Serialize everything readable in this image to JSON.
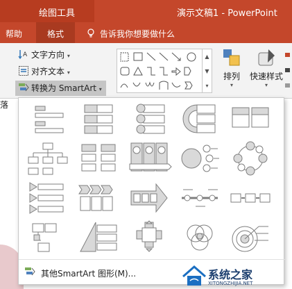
{
  "title_bar": {
    "drawing_tools": "绘图工具",
    "document_title": "演示文稿1  -  PowerPoint"
  },
  "menu": {
    "help": "帮助",
    "format": "格式",
    "tell_me": "告诉我你想要做什么"
  },
  "ribbon": {
    "text_direction": "文字方向",
    "align_text": "对齐文本",
    "convert_smartart": "转换为 SmartArt",
    "arrange": "排列",
    "quick_styles": "快速样式",
    "left_edge_char": "落"
  },
  "dropdown": {
    "more_smartart": "其他SmartArt 图形(M)...",
    "layout_icons": [
      "vertical-bullet-list-icon",
      "stacked-list-icon",
      "vertical-circle-list-icon",
      "trapezoid-list-icon",
      "grouped-list-icon",
      "hierarchy-icon",
      "horizontal-hierarchy-list-icon",
      "picture-column-process-icon",
      "circle-list-icon",
      "basic-cycle-icon",
      "vertical-chevron-list-icon",
      "chevron-process-icon",
      "upward-arrow-process-icon",
      "alternating-flow-icon",
      "basic-process-icon",
      "picture-accent-process-icon",
      "pyramid-list-icon",
      "cross-matrix-icon",
      "basic-venn-icon",
      "target-list-icon"
    ]
  },
  "watermark": {
    "name": "系统之家",
    "url": "XITONGZHIJIA.NET"
  },
  "colors": {
    "accent_red": "#c4472b",
    "icon_fill": "#d9d9d9",
    "icon_stroke": "#7f7f7f"
  }
}
